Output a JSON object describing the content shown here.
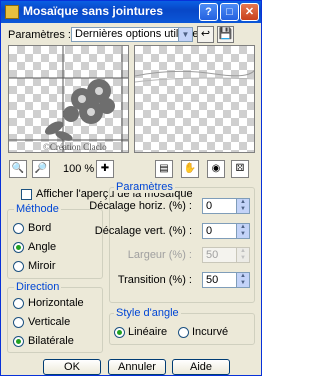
{
  "window": {
    "title": "Mosaïque sans jointures"
  },
  "presets": {
    "label": "Paramètres :",
    "value": "Dernières options utilisées"
  },
  "preview": {
    "watermark": "©Création Claclo"
  },
  "zoom": {
    "value": "100 %"
  },
  "show_mosaic_preview": {
    "label": "Afficher l'aperçu de la mosaïque",
    "checked": false
  },
  "methode": {
    "title": "Méthode",
    "options": [
      {
        "label": "Bord",
        "selected": false
      },
      {
        "label": "Angle",
        "selected": true
      },
      {
        "label": "Miroir",
        "selected": false
      }
    ]
  },
  "parametres": {
    "title": "Paramètres",
    "fields": [
      {
        "label": "Décalage horiz. (%) :",
        "value": "0",
        "enabled": true
      },
      {
        "label": "Décalage vert. (%) :",
        "value": "0",
        "enabled": true
      },
      {
        "label": "Largeur (%) :",
        "value": "50",
        "enabled": false
      },
      {
        "label": "Transition (%) :",
        "value": "50",
        "enabled": true
      }
    ]
  },
  "direction": {
    "title": "Direction",
    "options": [
      {
        "label": "Horizontale",
        "selected": false
      },
      {
        "label": "Verticale",
        "selected": false
      },
      {
        "label": "Bilatérale",
        "selected": true
      }
    ]
  },
  "style_angle": {
    "title": "Style d'angle",
    "options": [
      {
        "label": "Linéaire",
        "selected": true
      },
      {
        "label": "Incurvé",
        "selected": false
      }
    ]
  },
  "buttons": {
    "ok": "OK",
    "cancel": "Annuler",
    "help": "Aide"
  },
  "colors": {
    "title_bar": "#0a5fe3",
    "dialog_bg": "#ece9d8",
    "group_title": "#0046d5",
    "radio_dot": "#21a121"
  }
}
